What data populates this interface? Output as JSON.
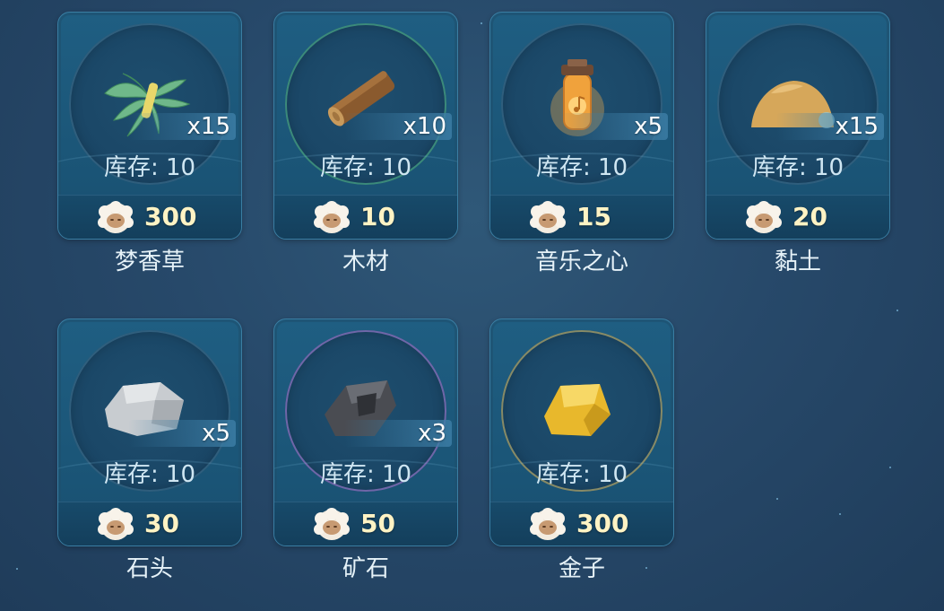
{
  "stock_label": "库存: 10",
  "items": [
    {
      "name": "梦香草",
      "qty": "x15",
      "price": "300",
      "icon": "grass-bundle-icon"
    },
    {
      "name": "木材",
      "qty": "x10",
      "price": "10",
      "icon": "wood-log-icon"
    },
    {
      "name": "音乐之心",
      "qty": "x5",
      "price": "15",
      "icon": "music-jar-icon"
    },
    {
      "name": "黏土",
      "qty": "x15",
      "price": "20",
      "icon": "clay-pile-icon"
    },
    {
      "name": "石头",
      "qty": "x5",
      "price": "30",
      "icon": "stone-icon"
    },
    {
      "name": "矿石",
      "qty": "x3",
      "price": "50",
      "icon": "ore-icon"
    },
    {
      "name": "金子",
      "qty": "",
      "price": "300",
      "icon": "gold-nugget-icon"
    }
  ],
  "currency_icon": "sheep-coin-icon",
  "colors": {
    "background": "#27496a",
    "tile": "#1f5e82",
    "price_text": "#fff3c4"
  }
}
